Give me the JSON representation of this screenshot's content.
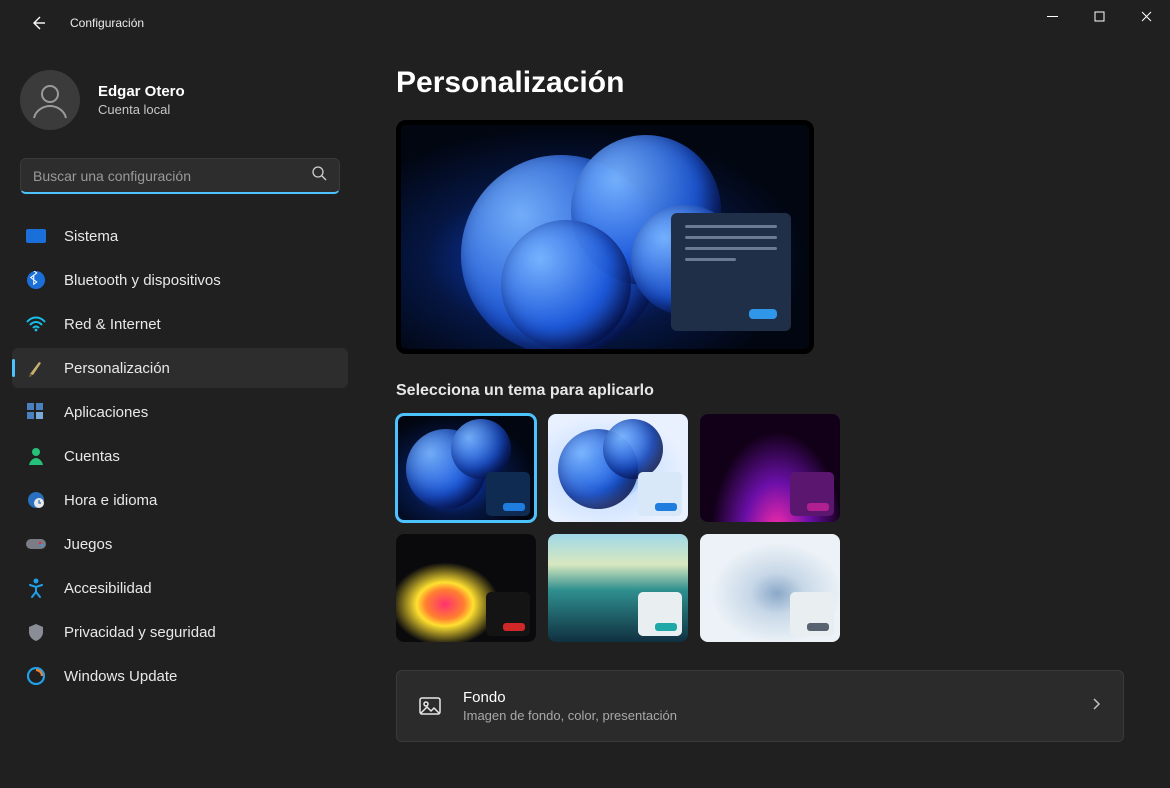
{
  "window": {
    "title": "Configuración"
  },
  "user": {
    "name": "Edgar Otero",
    "subtitle": "Cuenta local"
  },
  "search": {
    "placeholder": "Buscar una configuración"
  },
  "nav": {
    "items": [
      {
        "label": "Sistema"
      },
      {
        "label": "Bluetooth y dispositivos"
      },
      {
        "label": "Red & Internet"
      },
      {
        "label": "Personalización"
      },
      {
        "label": "Aplicaciones"
      },
      {
        "label": "Cuentas"
      },
      {
        "label": "Hora e idioma"
      },
      {
        "label": "Juegos"
      },
      {
        "label": "Accesibilidad"
      },
      {
        "label": "Privacidad y seguridad"
      },
      {
        "label": "Windows Update"
      }
    ]
  },
  "page": {
    "title": "Personalización",
    "theme_heading": "Selecciona un tema para aplicarlo"
  },
  "themes": [
    {
      "mini_bg": "#0f2b52",
      "pill": "#1f7de0",
      "selected": true
    },
    {
      "mini_bg": "#d8e8f8",
      "pill": "#1f7de0",
      "selected": false
    },
    {
      "mini_bg": "#5b1770",
      "pill": "#b02090",
      "selected": false
    },
    {
      "mini_bg": "#141414",
      "pill": "#d02828",
      "selected": false
    },
    {
      "mini_bg": "#e9eef0",
      "pill": "#1fa8a8",
      "selected": false
    },
    {
      "mini_bg": "#e9eef0",
      "pill": "#586270",
      "selected": false
    }
  ],
  "rows": {
    "fondo": {
      "title": "Fondo",
      "subtitle": "Imagen de fondo, color, presentación"
    }
  },
  "colors": {
    "accent": "#4cc2ff"
  }
}
